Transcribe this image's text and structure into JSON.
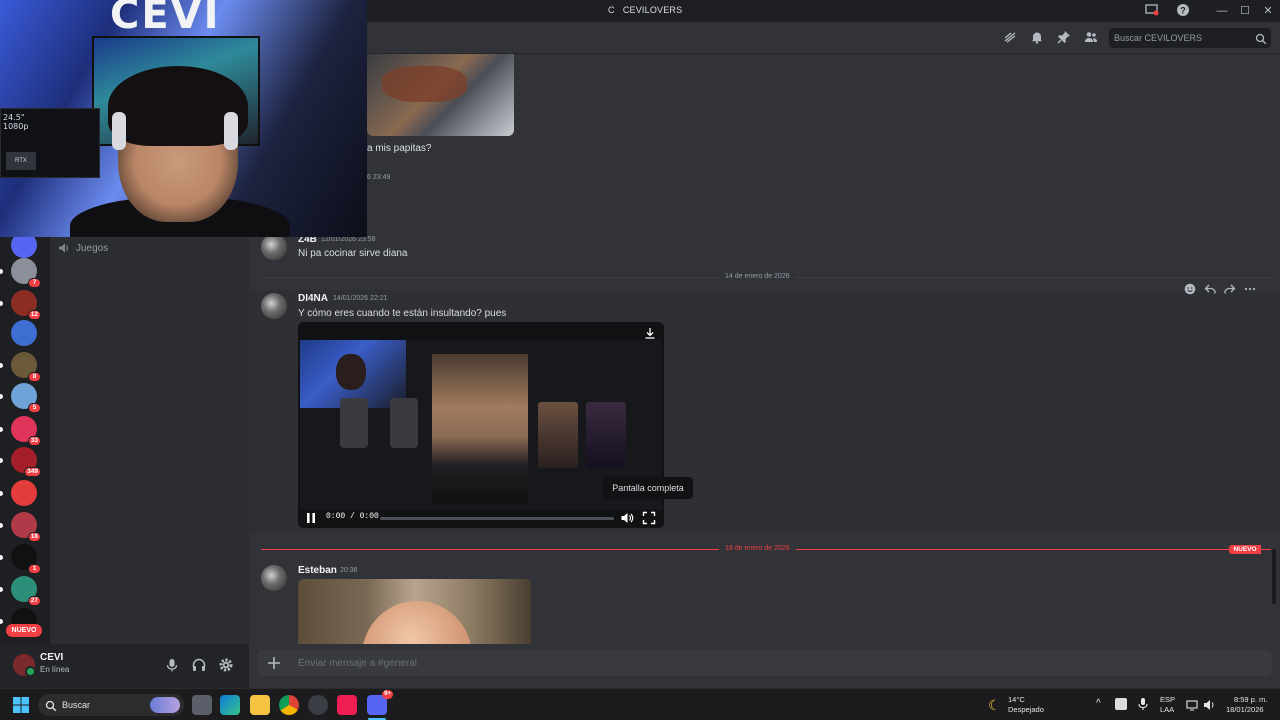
{
  "window": {
    "title": "CEVILOVERS",
    "title_prefix": "C"
  },
  "header": {
    "search_placeholder": "Buscar CEVILOVERS"
  },
  "rail": {
    "badges": [
      "7",
      "12",
      "8",
      "5",
      "33",
      "349",
      "18",
      "1",
      "27"
    ],
    "nuevo": "NUEVO"
  },
  "channels": {
    "voice_channel": "Juegos"
  },
  "user": {
    "name": "CEVI",
    "status": "En línea"
  },
  "messages": [
    {
      "text": "a mis papitas?",
      "time": "6 23:49"
    },
    {
      "author": "Z4B",
      "time": "12/01/2026 23:58",
      "text": "Ni pa cocinar sirve diana"
    },
    {
      "author": "DI4NA",
      "time": "14/01/2026 22:21",
      "text": "Y cómo eres cuando te están insultando? pues"
    },
    {
      "author": "Esteban",
      "time": "20:36"
    }
  ],
  "dividers": {
    "date1": "14 de enero de 2026",
    "date2": "18 de enero de 2026",
    "new_tag": "NUEVO"
  },
  "video": {
    "time": "0:00 / 0:00",
    "tooltip": "Pantalla completa",
    "progress": 0
  },
  "composer": {
    "placeholder": "Enviar mensaje a #general"
  },
  "webcam": {
    "wall_text": "CEVI",
    "monitor_text": "24.5\"\n1080p",
    "gpu_text": "RTX"
  },
  "taskbar": {
    "search": "Buscar",
    "weather_temp": "14°C",
    "weather_desc": "Despejado",
    "lang1": "ESP",
    "lang2": "LAA",
    "time": "8:59 p. m.",
    "date": "18/01/2026",
    "discord_badge": "9+"
  },
  "colors": {
    "accent_red": "#f23f43",
    "online_green": "#23a55a",
    "bg_main": "#313338",
    "bg_sidebar": "#2b2d31"
  }
}
